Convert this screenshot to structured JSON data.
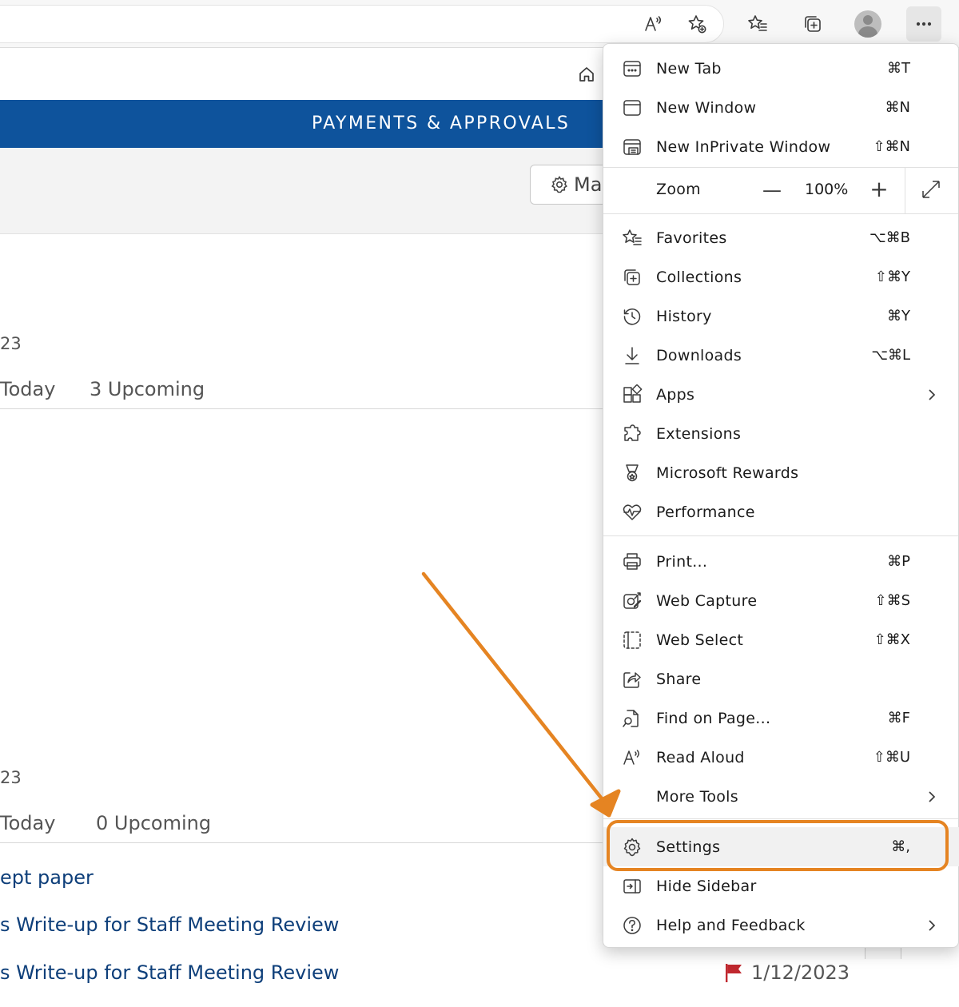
{
  "colors": {
    "nav_band": "#0e539c",
    "link_text": "#0e3f7a",
    "highlight": "#e58422",
    "flag": "#c0282f"
  },
  "toolbar": {
    "icons": [
      "read-aloud-icon",
      "add-favorite-icon",
      "favorites-icon",
      "collections-icon",
      "profile-avatar-icon",
      "more-icon"
    ]
  },
  "page": {
    "nav_title": "PAYMENTS & APPROVALS",
    "manage_button": "Ma",
    "section1": {
      "date_fragment": "23",
      "today": "Today",
      "upcoming": "3 Upcoming"
    },
    "section2": {
      "date_fragment": "23",
      "today": "Today",
      "upcoming": "0 Upcoming"
    },
    "tasks": [
      "ept paper",
      "s Write-up for Staff Meeting Review",
      "s Write-up for Staff Meeting Review"
    ],
    "due_date": "1/12/2023"
  },
  "menu": {
    "group1": [
      {
        "label": "New Tab",
        "shortcut": "⌘T",
        "icon": "new-tab-icon"
      },
      {
        "label": "New Window",
        "shortcut": "⌘N",
        "icon": "new-window-icon"
      },
      {
        "label": "New InPrivate Window",
        "shortcut": "⇧⌘N",
        "icon": "inprivate-window-icon"
      }
    ],
    "zoom": {
      "label": "Zoom",
      "minus": "—",
      "value": "100%",
      "plus": "+"
    },
    "group2": [
      {
        "label": "Favorites",
        "shortcut": "⌥⌘B",
        "icon": "favorites-icon"
      },
      {
        "label": "Collections",
        "shortcut": "⇧⌘Y",
        "icon": "collections-icon"
      },
      {
        "label": "History",
        "shortcut": "⌘Y",
        "icon": "history-icon"
      },
      {
        "label": "Downloads",
        "shortcut": "⌥⌘L",
        "icon": "downloads-icon"
      },
      {
        "label": "Apps",
        "shortcut": "",
        "icon": "apps-icon",
        "submenu": true
      },
      {
        "label": "Extensions",
        "shortcut": "",
        "icon": "extensions-icon"
      },
      {
        "label": "Microsoft Rewards",
        "shortcut": "",
        "icon": "rewards-icon"
      },
      {
        "label": "Performance",
        "shortcut": "",
        "icon": "performance-icon"
      }
    ],
    "group3": [
      {
        "label": "Print...",
        "shortcut": "⌘P",
        "icon": "print-icon"
      },
      {
        "label": "Web Capture",
        "shortcut": "⇧⌘S",
        "icon": "web-capture-icon"
      },
      {
        "label": "Web Select",
        "shortcut": "⇧⌘X",
        "icon": "web-select-icon"
      },
      {
        "label": "Share",
        "shortcut": "",
        "icon": "share-icon"
      },
      {
        "label": "Find on Page...",
        "shortcut": "⌘F",
        "icon": "find-on-page-icon"
      },
      {
        "label": "Read Aloud",
        "shortcut": "⇧⌘U",
        "icon": "read-aloud-icon"
      },
      {
        "label": "More Tools",
        "shortcut": "",
        "icon": "",
        "submenu": true
      }
    ],
    "group4": [
      {
        "label": "Settings",
        "shortcut": "⌘,",
        "icon": "settings-icon",
        "highlighted": true
      },
      {
        "label": "Hide Sidebar",
        "shortcut": "",
        "icon": "hide-sidebar-icon"
      },
      {
        "label": "Help and Feedback",
        "shortcut": "",
        "icon": "help-icon",
        "submenu": true
      }
    ]
  }
}
